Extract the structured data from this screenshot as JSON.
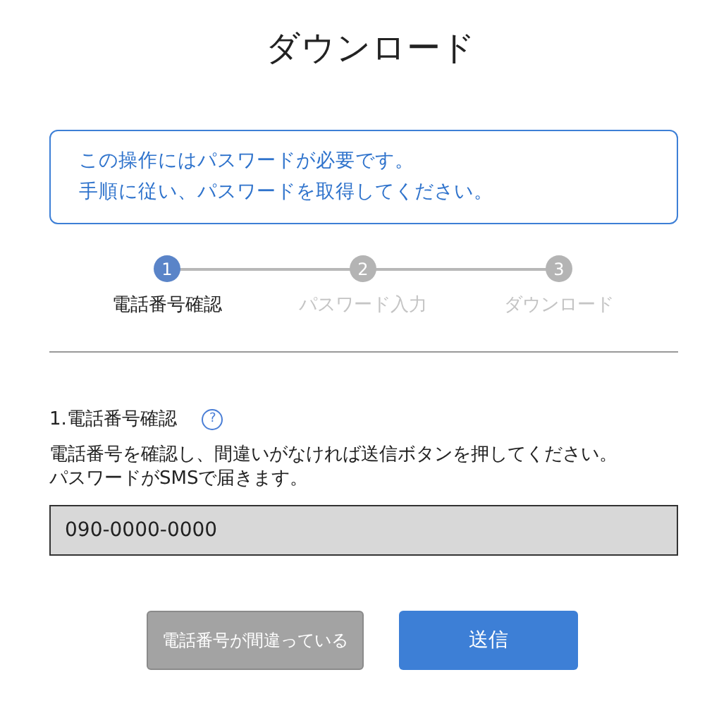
{
  "title": "ダウンロード",
  "notice": {
    "lines": [
      "この操作にはパスワードが必要です。",
      "手順に従い、パスワードを取得してください。"
    ]
  },
  "steps": [
    {
      "number": "1",
      "label": "電話番号確認",
      "selected": true
    },
    {
      "number": "2",
      "label": "パスワード入力",
      "selected": false
    },
    {
      "number": "3",
      "label": "ダウンロード",
      "selected": false
    }
  ],
  "section": {
    "heading": "1.電話番号確認",
    "help": "?",
    "description": [
      "電話番号を確認し、間違いがなければ送信ボタンを押してください。",
      "パスワードがSMSで届きます。"
    ]
  },
  "phone_field": {
    "value": "090-0000-0000"
  },
  "buttons": [
    {
      "label": "電話番号が間違っている",
      "kind": "secondary"
    },
    {
      "label": "送信",
      "kind": "primary"
    }
  ]
}
